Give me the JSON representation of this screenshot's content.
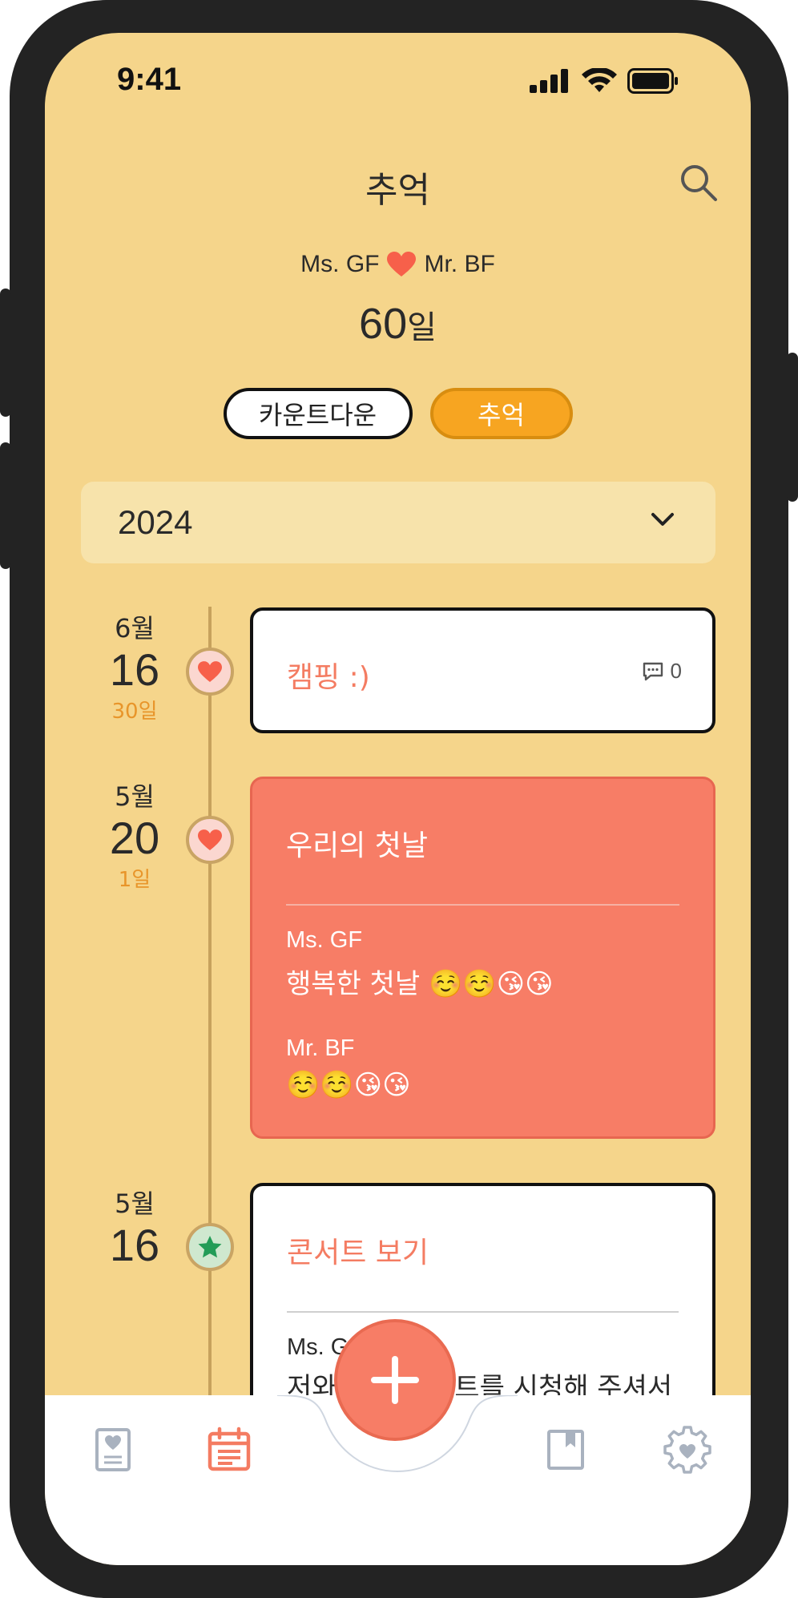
{
  "status_bar": {
    "time": "9:41"
  },
  "header": {
    "title": "추억"
  },
  "couple": {
    "left_name": "Ms. GF",
    "right_name": "Mr. BF"
  },
  "day_count": {
    "number": "60",
    "unit": "일"
  },
  "toggle": {
    "countdown_label": "카운트다운",
    "memory_label": "추억",
    "selected": "추억"
  },
  "year_select": {
    "value": "2024"
  },
  "timeline": [
    {
      "month": "6월",
      "day": "16",
      "since": "30일",
      "icon": "heart-icon",
      "title": "캠핑 :)",
      "comments": "0"
    },
    {
      "month": "5월",
      "day": "20",
      "since": "1일",
      "icon": "heart-icon",
      "title": "우리의 첫날",
      "entries": [
        {
          "author": "Ms. GF",
          "message": "행복한 첫날 ☺️☺️😘😘"
        },
        {
          "author": "Mr. BF",
          "message": "☺️☺️😘😘"
        }
      ]
    },
    {
      "month": "5월",
      "day": "16",
      "icon": "star-icon",
      "title": "콘서트 보기",
      "entries": [
        {
          "author": "Ms. GF",
          "message": "저와 함께 콘서트를 시청해 주셔서 감사합니다 :)"
        }
      ]
    }
  ],
  "tabbar": {
    "items": [
      "diary-icon",
      "calendar-icon",
      "add-icon",
      "bookmark-icon",
      "settings-icon"
    ],
    "active": "calendar-icon"
  },
  "colors": {
    "background": "#f5d58b",
    "accent": "#f7a521",
    "coral": "#f77d66",
    "tab_active": "#f47c62",
    "tab_inactive": "#a9b2bf"
  }
}
